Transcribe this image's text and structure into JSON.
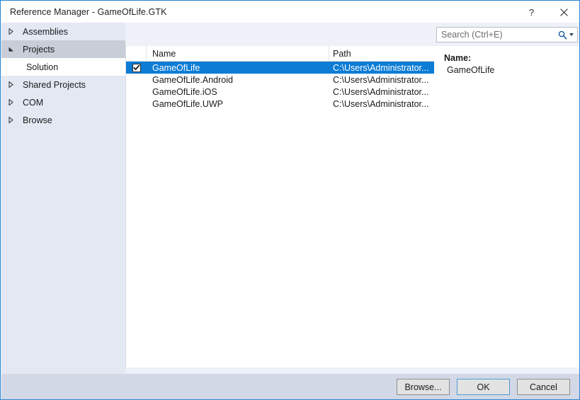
{
  "window": {
    "title": "Reference Manager - GameOfLife.GTK",
    "help_label": "?",
    "close_label": "×",
    "accent_color": "#0c7cd5",
    "border_color": "#2b88d8",
    "sidebar_color": "#e3e8f3",
    "footer_color": "#d2d8e6"
  },
  "sidebar": {
    "items": [
      {
        "label": "Assemblies",
        "state": "collapsed",
        "level": 1
      },
      {
        "label": "Projects",
        "state": "expanded",
        "level": 1
      },
      {
        "label": "Solution",
        "state": "selected",
        "level": 2
      },
      {
        "label": "Shared Projects",
        "state": "collapsed",
        "level": 1
      },
      {
        "label": "COM",
        "state": "collapsed",
        "level": 1
      },
      {
        "label": "Browse",
        "state": "collapsed",
        "level": 1
      }
    ]
  },
  "search": {
    "placeholder": "Search (Ctrl+E)",
    "value": "",
    "icon": "search-icon",
    "dropdown_icon": "chevron-down-icon"
  },
  "list": {
    "columns": [
      "",
      "Name",
      "Path"
    ],
    "rows": [
      {
        "checked": true,
        "name": "GameOfLife",
        "path": "C:\\Users\\Administrator...",
        "selected": true
      },
      {
        "checked": false,
        "name": "GameOfLife.Android",
        "path": "C:\\Users\\Administrator...",
        "selected": false
      },
      {
        "checked": false,
        "name": "GameOfLife.iOS",
        "path": "C:\\Users\\Administrator...",
        "selected": false
      },
      {
        "checked": false,
        "name": "GameOfLife.UWP",
        "path": "C:\\Users\\Administrator...",
        "selected": false
      }
    ]
  },
  "detail": {
    "name_label": "Name:",
    "name_value": "GameOfLife"
  },
  "footer": {
    "browse_label": "Browse...",
    "ok_label": "OK",
    "cancel_label": "Cancel"
  }
}
